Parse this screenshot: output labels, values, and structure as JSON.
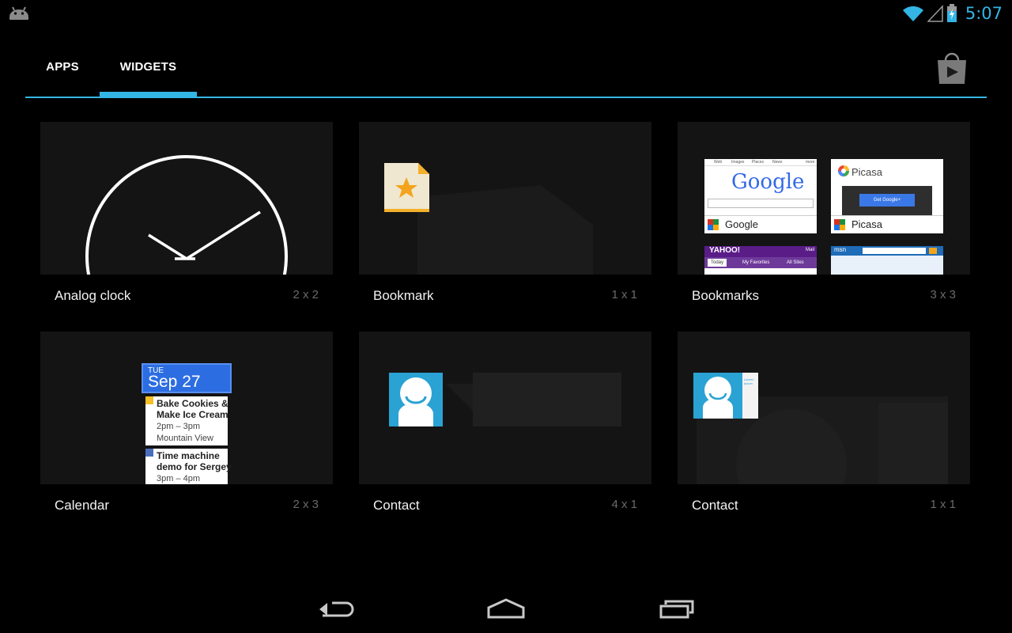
{
  "status_bar": {
    "time": "5:07",
    "icons": [
      "android-icon",
      "wifi-icon",
      "signal-icon",
      "battery-charging-icon"
    ]
  },
  "tabs": [
    {
      "label": "APPS",
      "selected": false
    },
    {
      "label": "WIDGETS",
      "selected": true
    }
  ],
  "store_button": {
    "icon": "play-store-icon"
  },
  "widgets": [
    {
      "name": "Analog clock",
      "size": "2 x 2"
    },
    {
      "name": "Bookmark",
      "size": "1 x 1"
    },
    {
      "name": "Bookmarks",
      "size": "3 x 3"
    },
    {
      "name": "Calendar",
      "size": "2 x 3"
    },
    {
      "name": "Contact",
      "size": "4 x 1"
    },
    {
      "name": "Contact",
      "size": "1 x 1"
    }
  ],
  "bookmarks_preview": {
    "google": {
      "logo": "Google",
      "label": "Google",
      "tabs": [
        "Web",
        "Images",
        "Places",
        "News",
        "more"
      ]
    },
    "picasa": {
      "title": "Picasa",
      "label": "Picasa",
      "button": "Get Google+"
    },
    "yahoo": {
      "logo": "YAHOO!",
      "mail": "Mail",
      "tabs": [
        "Today",
        "My Favorites",
        "All Sites"
      ]
    },
    "msn": {
      "logo": "msn"
    }
  },
  "calendar_preview": {
    "day_of_week": "TUE",
    "date": "Sep 27",
    "events": [
      {
        "title_line1": "Bake Cookies &",
        "title_line2": "Make Ice Cream",
        "time": "2pm – 3pm",
        "location": "Mountain View",
        "color": "#f6bf26"
      },
      {
        "title_line1": "Time machine",
        "title_line2": "demo for Sergey",
        "time": "3pm – 4pm",
        "color": "#4a6fbf"
      }
    ]
  },
  "contact_preview": {
    "card_text": "Lauren Ipsum"
  },
  "colors": {
    "accent": "#33b5e5",
    "background": "#000000",
    "card": "#141414",
    "size_text": "#6a6a6a"
  },
  "nav_bar": {
    "icons": [
      "back-icon",
      "home-icon",
      "recent-apps-icon"
    ]
  }
}
